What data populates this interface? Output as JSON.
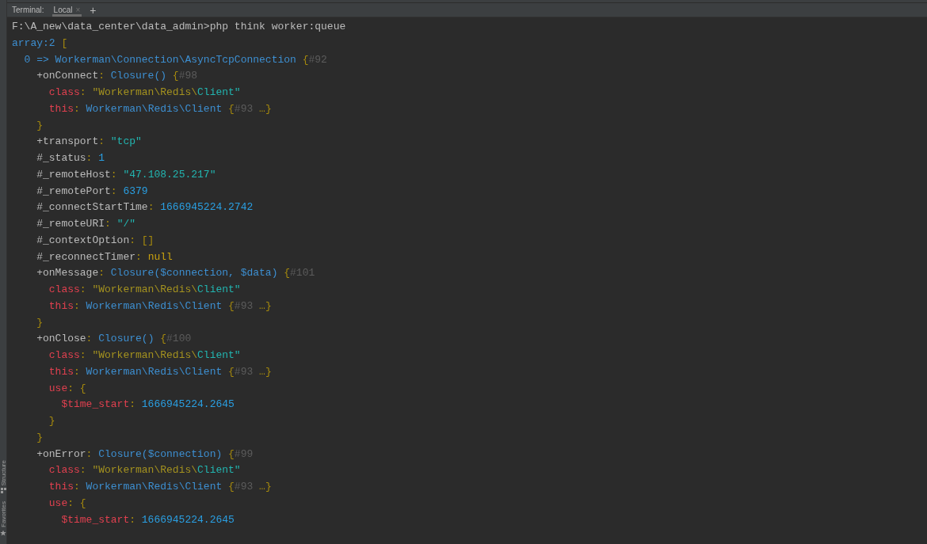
{
  "toolwindow": {
    "label": "Terminal:",
    "tabs": [
      {
        "label": "Local",
        "selected": true,
        "close": "×"
      }
    ],
    "add": "+"
  },
  "command": "F:\\A_new\\data_center\\data_admin>php think worker:queue",
  "dump": [
    {
      "tokens": [
        {
          "kind": "type",
          "text": "array:2"
        },
        {
          "kind": "punct",
          "text": " ["
        }
      ],
      "children": [
        {
          "tokens": [
            {
              "kind": "type",
              "text": "0 => Workerman\\Connection\\AsyncTcpConnection"
            },
            {
              "kind": "punct",
              "text": " {"
            },
            {
              "kind": "ref",
              "text": "#92"
            }
          ],
          "children": [
            {
              "tokens": [
                {
                  "kind": "plain",
                  "text": "+onConnect"
                },
                {
                  "kind": "punct",
                  "text": ":"
                },
                {
                  "kind": "type",
                  "text": " Closure()"
                },
                {
                  "kind": "punct",
                  "text": " {"
                },
                {
                  "kind": "ref",
                  "text": "#98"
                }
              ],
              "closing": [
                {
                  "kind": "punct",
                  "text": "}"
                }
              ],
              "children": [
                {
                  "tokens": [
                    {
                      "kind": "red",
                      "text": "class"
                    },
                    {
                      "kind": "punct",
                      "text": ":"
                    },
                    {
                      "kind": "string",
                      "text": " \"Workerman\\Redis\\"
                    },
                    {
                      "kind": "cyan",
                      "text": "Client\""
                    }
                  ]
                },
                {
                  "tokens": [
                    {
                      "kind": "red",
                      "text": "this"
                    },
                    {
                      "kind": "punct",
                      "text": ":"
                    },
                    {
                      "kind": "type",
                      "text": " Workerman\\Redis\\Client"
                    },
                    {
                      "kind": "punct",
                      "text": " {"
                    },
                    {
                      "kind": "ref",
                      "text": "#93 "
                    },
                    {
                      "kind": "punct",
                      "text": "…}"
                    }
                  ]
                }
              ]
            },
            {
              "tokens": [
                {
                  "kind": "plain",
                  "text": "+transport"
                },
                {
                  "kind": "punct",
                  "text": ":"
                },
                {
                  "kind": "cyan",
                  "text": " \"tcp\""
                }
              ]
            },
            {
              "tokens": [
                {
                  "kind": "plain",
                  "text": "#_status"
                },
                {
                  "kind": "punct",
                  "text": ":"
                },
                {
                  "kind": "number",
                  "text": " 1"
                }
              ]
            },
            {
              "tokens": [
                {
                  "kind": "plain",
                  "text": "#_remoteHost"
                },
                {
                  "kind": "punct",
                  "text": ":"
                },
                {
                  "kind": "cyan",
                  "text": " \"47.108.25.217\""
                }
              ]
            },
            {
              "tokens": [
                {
                  "kind": "plain",
                  "text": "#_remotePort"
                },
                {
                  "kind": "punct",
                  "text": ":"
                },
                {
                  "kind": "number",
                  "text": " 6379"
                }
              ]
            },
            {
              "tokens": [
                {
                  "kind": "plain",
                  "text": "#_connectStartTime"
                },
                {
                  "kind": "punct",
                  "text": ":"
                },
                {
                  "kind": "number",
                  "text": " 1666945224.2742"
                }
              ]
            },
            {
              "tokens": [
                {
                  "kind": "plain",
                  "text": "#_remoteURI"
                },
                {
                  "kind": "punct",
                  "text": ":"
                },
                {
                  "kind": "cyan",
                  "text": " \"/\""
                }
              ]
            },
            {
              "tokens": [
                {
                  "kind": "plain",
                  "text": "#_contextOption"
                },
                {
                  "kind": "punct",
                  "text": ": []"
                }
              ]
            },
            {
              "tokens": [
                {
                  "kind": "plain",
                  "text": "#_reconnectTimer"
                },
                {
                  "kind": "punct",
                  "text": ":"
                },
                {
                  "kind": "keyword",
                  "text": " null"
                }
              ]
            },
            {
              "tokens": [
                {
                  "kind": "plain",
                  "text": "+onMessage"
                },
                {
                  "kind": "punct",
                  "text": ":"
                },
                {
                  "kind": "type",
                  "text": " Closure($connection, $data)"
                },
                {
                  "kind": "punct",
                  "text": " {"
                },
                {
                  "kind": "ref",
                  "text": "#101"
                }
              ],
              "closing": [
                {
                  "kind": "punct",
                  "text": "}"
                }
              ],
              "children": [
                {
                  "tokens": [
                    {
                      "kind": "red",
                      "text": "class"
                    },
                    {
                      "kind": "punct",
                      "text": ":"
                    },
                    {
                      "kind": "string",
                      "text": " \"Workerman\\Redis\\"
                    },
                    {
                      "kind": "cyan",
                      "text": "Client\""
                    }
                  ]
                },
                {
                  "tokens": [
                    {
                      "kind": "red",
                      "text": "this"
                    },
                    {
                      "kind": "punct",
                      "text": ":"
                    },
                    {
                      "kind": "type",
                      "text": " Workerman\\Redis\\Client"
                    },
                    {
                      "kind": "punct",
                      "text": " {"
                    },
                    {
                      "kind": "ref",
                      "text": "#93 "
                    },
                    {
                      "kind": "punct",
                      "text": "…}"
                    }
                  ]
                }
              ]
            },
            {
              "tokens": [
                {
                  "kind": "plain",
                  "text": "+onClose"
                },
                {
                  "kind": "punct",
                  "text": ":"
                },
                {
                  "kind": "type",
                  "text": " Closure()"
                },
                {
                  "kind": "punct",
                  "text": " {"
                },
                {
                  "kind": "ref",
                  "text": "#100"
                }
              ],
              "closing": [
                {
                  "kind": "punct",
                  "text": "}"
                }
              ],
              "children": [
                {
                  "tokens": [
                    {
                      "kind": "red",
                      "text": "class"
                    },
                    {
                      "kind": "punct",
                      "text": ":"
                    },
                    {
                      "kind": "string",
                      "text": " \"Workerman\\Redis\\"
                    },
                    {
                      "kind": "cyan",
                      "text": "Client\""
                    }
                  ]
                },
                {
                  "tokens": [
                    {
                      "kind": "red",
                      "text": "this"
                    },
                    {
                      "kind": "punct",
                      "text": ":"
                    },
                    {
                      "kind": "type",
                      "text": " Workerman\\Redis\\Client"
                    },
                    {
                      "kind": "punct",
                      "text": " {"
                    },
                    {
                      "kind": "ref",
                      "text": "#93 "
                    },
                    {
                      "kind": "punct",
                      "text": "…}"
                    }
                  ]
                },
                {
                  "tokens": [
                    {
                      "kind": "red",
                      "text": "use"
                    },
                    {
                      "kind": "punct",
                      "text": ": {"
                    }
                  ],
                  "closing": [
                    {
                      "kind": "punct",
                      "text": "}"
                    }
                  ],
                  "children": [
                    {
                      "tokens": [
                        {
                          "kind": "red",
                          "text": "$time_start"
                        },
                        {
                          "kind": "punct",
                          "text": ":"
                        },
                        {
                          "kind": "number",
                          "text": " 1666945224.2645"
                        }
                      ]
                    }
                  ]
                }
              ]
            },
            {
              "tokens": [
                {
                  "kind": "plain",
                  "text": "+onError"
                },
                {
                  "kind": "punct",
                  "text": ":"
                },
                {
                  "kind": "type",
                  "text": " Closure($connection)"
                },
                {
                  "kind": "punct",
                  "text": " {"
                },
                {
                  "kind": "ref",
                  "text": "#99"
                }
              ],
              "children": [
                {
                  "tokens": [
                    {
                      "kind": "red",
                      "text": "class"
                    },
                    {
                      "kind": "punct",
                      "text": ":"
                    },
                    {
                      "kind": "string",
                      "text": " \"Workerman\\Redis\\"
                    },
                    {
                      "kind": "cyan",
                      "text": "Client\""
                    }
                  ]
                },
                {
                  "tokens": [
                    {
                      "kind": "red",
                      "text": "this"
                    },
                    {
                      "kind": "punct",
                      "text": ":"
                    },
                    {
                      "kind": "type",
                      "text": " Workerman\\Redis\\Client"
                    },
                    {
                      "kind": "punct",
                      "text": " {"
                    },
                    {
                      "kind": "ref",
                      "text": "#93 "
                    },
                    {
                      "kind": "punct",
                      "text": "…}"
                    }
                  ]
                },
                {
                  "tokens": [
                    {
                      "kind": "red",
                      "text": "use"
                    },
                    {
                      "kind": "punct",
                      "text": ": {"
                    }
                  ],
                  "children": [
                    {
                      "tokens": [
                        {
                          "kind": "red",
                          "text": "$time_start"
                        },
                        {
                          "kind": "punct",
                          "text": ":"
                        },
                        {
                          "kind": "number",
                          "text": " 1666945224.2645"
                        }
                      ]
                    }
                  ]
                }
              ]
            }
          ]
        }
      ]
    }
  ],
  "side_tabs": [
    {
      "label": "Structure",
      "kind": "structure"
    },
    {
      "label": "Favorites",
      "kind": "favorites"
    }
  ]
}
